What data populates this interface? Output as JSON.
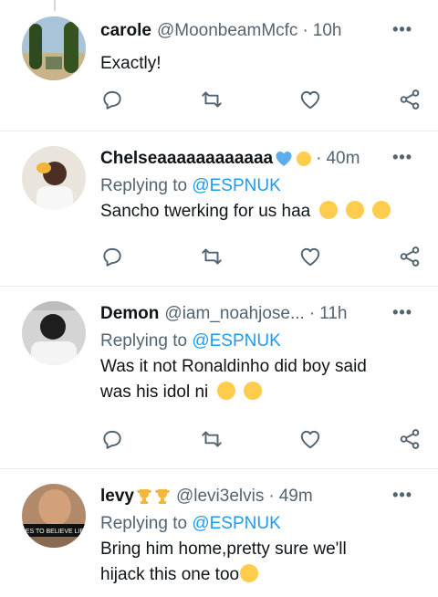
{
  "tweets": [
    {
      "name": "carole",
      "handle": "@MoonbeamMcfc",
      "time": "10h",
      "replying_prefix": "",
      "replying_to": "",
      "text_lines": [
        "Exactly!"
      ],
      "avatar_icon": "avatar-carole"
    },
    {
      "name": "Chelseaaaaaaaaaaaa",
      "handle": "",
      "time": "40m",
      "replying_prefix": "Replying to ",
      "replying_to": "@ESPNUK",
      "text_lines": [
        "Sancho twerking for us haa"
      ],
      "avatar_icon": "avatar-chelsea"
    },
    {
      "name": "Demon",
      "handle": "@iam_noahjose...",
      "time": "11h",
      "replying_prefix": "Replying to ",
      "replying_to": "@ESPNUK",
      "text_lines": [
        "Was it not Ronaldinho did boy said",
        "was his idol ni"
      ],
      "avatar_icon": "avatar-demon"
    },
    {
      "name": "levy",
      "handle": "@levi3elvis",
      "time": "49m",
      "replying_prefix": "Replying to ",
      "replying_to": "@ESPNUK",
      "text_lines": [
        "Bring him home,pretty sure we'll",
        "hijack this one too"
      ],
      "avatar_icon": "avatar-levy",
      "avatar_caption": "IES TO BELIEVE LIE"
    }
  ],
  "more_label": "•••",
  "dot": "·",
  "action_icons": [
    "reply-icon",
    "retweet-icon",
    "like-icon",
    "share-icon"
  ],
  "colors": {
    "accent": "#1d9bf0",
    "muted": "#536471",
    "text": "#0f1419",
    "divider": "#e6ecf0"
  }
}
